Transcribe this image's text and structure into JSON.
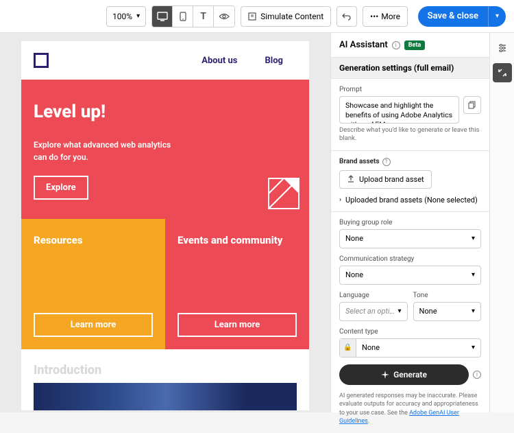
{
  "toolbar": {
    "zoom": "100%",
    "simulate": "Simulate Content",
    "more": "More",
    "save": "Save & close"
  },
  "email": {
    "nav": {
      "about": "About us",
      "blog": "Blog"
    },
    "hero": {
      "title": "Level up!",
      "sub": "Explore what advanced web analytics can do for you.",
      "cta": "Explore"
    },
    "card1": {
      "title": "Resources",
      "cta": "Learn more"
    },
    "card2": {
      "title": "Events and community",
      "cta": "Learn more"
    },
    "intro": "Introduction"
  },
  "panel": {
    "title": "AI Assistant",
    "beta": "Beta",
    "section": "Generation settings (full email)",
    "prompt_label": "Prompt",
    "prompt_value": "Showcase and highlight the benefits of using Adobe Analytics with an AEM",
    "prompt_help": "Describe what you'd like to generate or leave this blank.",
    "brand_label": "Brand assets",
    "upload": "Upload brand asset",
    "uploaded": "Uploaded brand assets (None selected)",
    "buying_label": "Buying group role",
    "buying_value": "None",
    "comm_label": "Communication strategy",
    "comm_value": "None",
    "lang_label": "Language",
    "lang_value": "Select an opti…",
    "tone_label": "Tone",
    "tone_value": "None",
    "ct_label": "Content type",
    "ct_value": "None",
    "generate": "Generate",
    "disclaimer_pre": "AI generated responses may be inaccurate. Please evaluate outputs for accuracy and appropriateness to your use case. See the ",
    "disclaimer_link": "Adobe GenAI User Guidelines"
  }
}
